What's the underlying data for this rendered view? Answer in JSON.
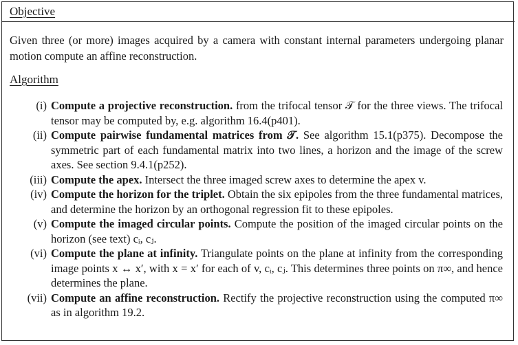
{
  "objective": {
    "heading": "Objective",
    "text": "Given three (or more) images acquired by a camera with constant internal parameters undergoing planar motion compute an affine reconstruction."
  },
  "algorithm": {
    "heading": "Algorithm",
    "steps": [
      {
        "num": "(i)",
        "title": "Compute a projective reconstruction.",
        "body": " from the trifocal tensor 𝒯 for the three views. The trifocal tensor may be computed by, e.g. algorithm 16.4(p401)."
      },
      {
        "num": "(ii)",
        "title": "Compute pairwise fundamental matrices from 𝒯.",
        "body": " See algorithm 15.1(p375). Decompose the symmetric part of each fundamental matrix into two lines, a horizon and the image of the screw axes. See section 9.4.1(p252)."
      },
      {
        "num": "(iii)",
        "title": "Compute the apex.",
        "body": " Intersect the three imaged screw axes to determine the apex v."
      },
      {
        "num": "(iv)",
        "title": "Compute the horizon for the triplet.",
        "body": " Obtain the six epipoles from the three fundamental matrices, and determine the horizon by an orthogonal regression fit to these epipoles."
      },
      {
        "num": "(v)",
        "title": "Compute the imaged circular points.",
        "body": " Compute the position of the imaged circular points on the horizon (see text) cᵢ, cⱼ."
      },
      {
        "num": "(vi)",
        "title": "Compute the plane at infinity.",
        "body": " Triangulate points on the plane at infinity from the corresponding image points x ↔ x′, with x = x′ for each of v, cᵢ, cⱼ. This determines three points on π∞, and hence determines the plane."
      },
      {
        "num": "(vii)",
        "title": "Compute an affine reconstruction.",
        "body": " Rectify the projective reconstruction using the computed π∞ as in algorithm 19.2."
      }
    ]
  }
}
